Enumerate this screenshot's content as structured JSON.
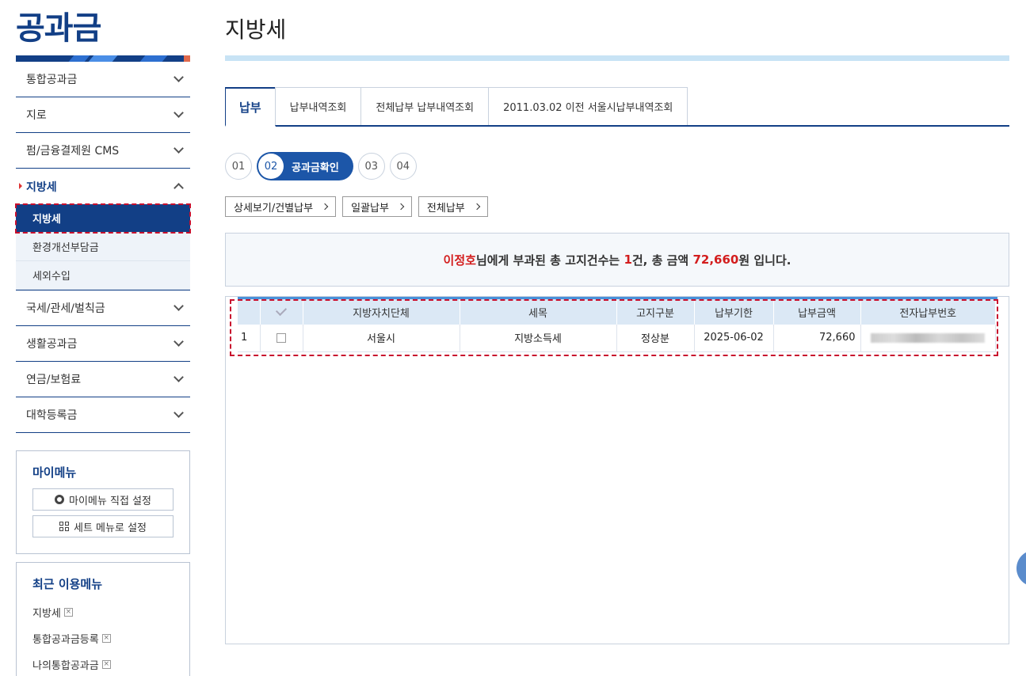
{
  "brand": "공과금",
  "sidebar": {
    "items_top": [
      {
        "label": "통합공과금"
      },
      {
        "label": "지로"
      },
      {
        "label": "펌/금융결제원 CMS"
      }
    ],
    "active": {
      "label": "지방세"
    },
    "sub_items": [
      {
        "label": "지방세"
      },
      {
        "label": "환경개선부담금"
      },
      {
        "label": "세외수입"
      }
    ],
    "items_bottom": [
      {
        "label": "국세/관세/벌칙금"
      },
      {
        "label": "생활공과금"
      },
      {
        "label": "연금/보험료"
      },
      {
        "label": "대학등록금"
      }
    ]
  },
  "my_menu": {
    "title": "마이메뉴",
    "direct_setting": "마이메뉴 직접 설정",
    "set_menu": "세트 메뉴로 설정"
  },
  "recent_menu": {
    "title": "최근 이용메뉴",
    "items": [
      "지방세",
      "통합공과금등록",
      "나의통합공과금"
    ]
  },
  "page": {
    "title": "지방세"
  },
  "tabs": [
    "납부",
    "납부내역조회",
    "전체납부 납부내역조회",
    "2011.03.02 이전 서울시납부내역조회"
  ],
  "steps": {
    "s1": "01",
    "s2": "02",
    "s2_label": "공과금확인",
    "s3": "03",
    "s4": "04"
  },
  "subtabs": [
    "상세보기/건별납부",
    "일괄납부",
    "전체납부"
  ],
  "summary": {
    "name": "이정호",
    "text1": "님에게 부과된 총 고지건수는 ",
    "count": "1",
    "text2": "건, 총 금액 ",
    "amount": "72,660",
    "text3": "원 입니다."
  },
  "table": {
    "headers": [
      "",
      "",
      "지방자치단체",
      "세목",
      "고지구분",
      "납부기한",
      "납부금액",
      "전자납부번호"
    ],
    "rows": [
      {
        "no": "1",
        "org": "서울시",
        "tax": "지방소득세",
        "type": "정상분",
        "due": "2025-06-02",
        "amount": "72,660"
      }
    ]
  }
}
